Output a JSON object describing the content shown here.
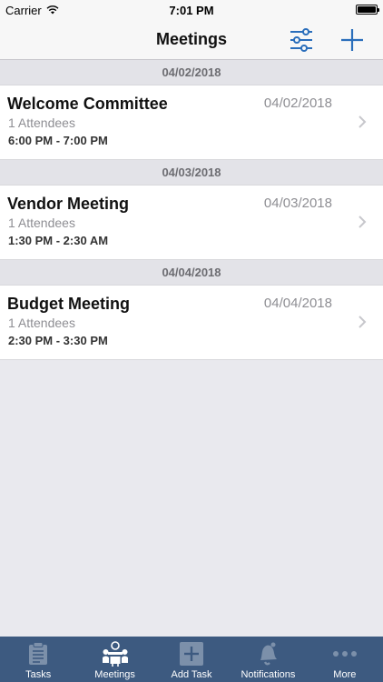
{
  "status_bar": {
    "carrier": "Carrier",
    "time": "7:01 PM"
  },
  "nav": {
    "title": "Meetings",
    "filter_icon": "sliders-icon",
    "add_icon": "plus-icon"
  },
  "sections": [
    {
      "header": "04/02/2018",
      "items": [
        {
          "title": "Welcome Committee",
          "date": "04/02/2018",
          "attendees": "1 Attendees",
          "time": "6:00 PM - 7:00 PM"
        }
      ]
    },
    {
      "header": "04/03/2018",
      "items": [
        {
          "title": "Vendor Meeting",
          "date": "04/03/2018",
          "attendees": "1 Attendees",
          "time": "1:30 PM - 2:30 AM"
        }
      ]
    },
    {
      "header": "04/04/2018",
      "items": [
        {
          "title": "Budget Meeting",
          "date": "04/04/2018",
          "attendees": "1 Attendees",
          "time": "2:30 PM - 3:30 PM"
        }
      ]
    }
  ],
  "tabs": [
    {
      "label": "Tasks",
      "icon": "clipboard-icon",
      "active": false
    },
    {
      "label": "Meetings",
      "icon": "meeting-icon",
      "active": true
    },
    {
      "label": "Add Task",
      "icon": "add-task-icon",
      "active": false
    },
    {
      "label": "Notifications",
      "icon": "bell-icon",
      "active": false
    },
    {
      "label": "More",
      "icon": "more-icon",
      "active": false
    }
  ],
  "colors": {
    "accent": "#2a6ebb",
    "tab_bar": "#3d5a80",
    "section_header": "#e3e3e8"
  }
}
